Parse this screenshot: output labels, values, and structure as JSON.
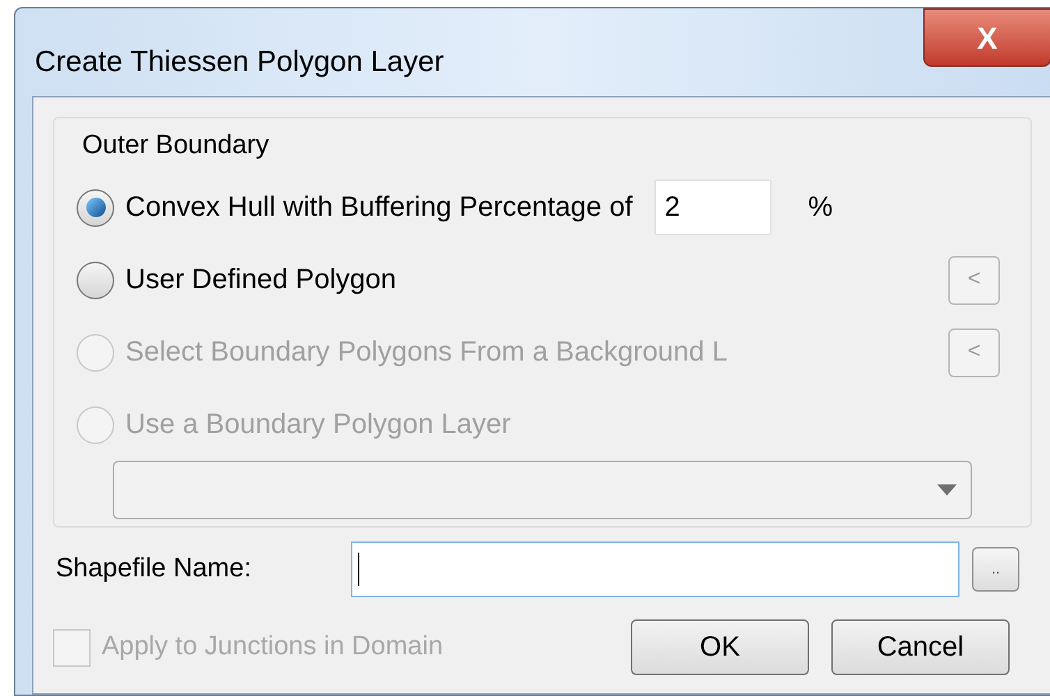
{
  "window": {
    "title": "Create Thiessen Polygon Layer",
    "close_label": "X"
  },
  "group": {
    "title": "Outer Boundary",
    "options": [
      {
        "kind": "percent",
        "label": "Convex Hull with Buffering Percentage of",
        "selected": true,
        "disabled": false,
        "value": "2",
        "unit": "%"
      },
      {
        "kind": "pick",
        "label": "User Defined Polygon",
        "selected": false,
        "disabled": false,
        "button": "<"
      },
      {
        "kind": "pick",
        "label": "Select Boundary Polygons From a Background L",
        "selected": false,
        "disabled": true,
        "button": "<"
      },
      {
        "kind": "layer",
        "label": "Use a Boundary Polygon Layer",
        "selected": false,
        "disabled": true
      }
    ]
  },
  "shapefile": {
    "label": "Shapefile Name:",
    "browse": ".."
  },
  "apply_junctions": {
    "label": "Apply to Junctions in Domain",
    "checked": false,
    "disabled": true
  },
  "buttons": [
    "OK",
    "Cancel"
  ]
}
